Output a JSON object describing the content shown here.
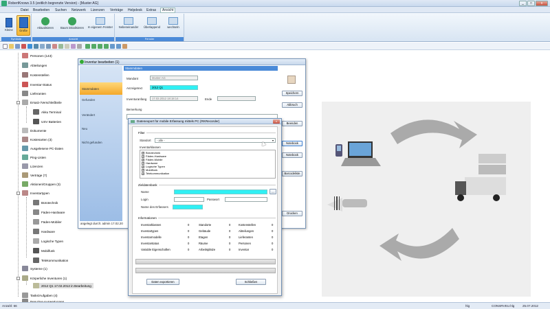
{
  "window": {
    "title": "RobertKnows 3.5 (zeitlich begrenzte Version) - [Muster AG]",
    "min": "_",
    "max": "□",
    "close": "x"
  },
  "menu": [
    "Datei",
    "Bearbeiten",
    "Suchen",
    "Netzwerk",
    "Lizenzen",
    "Verträge",
    "Helpdesk",
    "Extras",
    "Ansicht"
  ],
  "menu_active": "Ansicht",
  "ribbon": {
    "groups": [
      {
        "label": "Symbole",
        "buttons": [
          "Kleine",
          "Große"
        ]
      },
      {
        "label": "Ansicht",
        "buttons": [
          "Aktualisieren",
          "Baum initialisieren",
          "In eigenem Fenster"
        ]
      },
      {
        "label": "Fenster",
        "buttons": [
          "Nebeneinander",
          "Überlappend",
          "wechseln"
        ]
      }
    ],
    "selected": "Große"
  },
  "tree": [
    {
      "label": "Personen (143)",
      "color": "#c77"
    },
    {
      "label": "Abteilungen",
      "color": "#799"
    },
    {
      "label": "Kostenstellen",
      "color": "#977"
    },
    {
      "label": "Inventar-Status",
      "color": "#c55"
    },
    {
      "label": "Lieferanten",
      "color": "#888"
    },
    {
      "label": "Ersatz-/Verschleißteile",
      "color": "#aaa"
    },
    {
      "label": "Akku Terminal",
      "color": "#666"
    },
    {
      "label": "USV Batterien",
      "color": "#555"
    },
    {
      "label": "Dokumente",
      "color": "#bbb"
    },
    {
      "label": "Kostenarten (3)",
      "color": "#a88"
    },
    {
      "label": "Ausgelesene PC-Daten",
      "color": "#69a"
    },
    {
      "label": "Ping-Listen",
      "color": "#6a9"
    },
    {
      "label": "Lizenzen",
      "color": "#99a"
    },
    {
      "label": "Verträge (7)",
      "color": "#a97"
    },
    {
      "label": "Aktionen/Gruppen (3)",
      "color": "#7a6"
    },
    {
      "label": "Inventartypen",
      "color": "#b88"
    },
    {
      "label": "Bürotechnik",
      "color": "#777"
    },
    {
      "label": "Fäden-Hardware",
      "color": "#888"
    },
    {
      "label": "Fäden-Mobiler",
      "color": "#999"
    },
    {
      "label": "Hardware",
      "color": "#777"
    },
    {
      "label": "Logische Typen",
      "color": "#aaa"
    },
    {
      "label": "Mobilfunk",
      "color": "#555"
    },
    {
      "label": "Telekommunikation",
      "color": "#666"
    },
    {
      "label": "Systeme (1)",
      "color": "#889"
    },
    {
      "label": "Körperliche Inventuren (1)",
      "color": "#aa8"
    },
    {
      "label": "2012 Q1 17.02.2012 in Bearbeitung",
      "color": "#bb9"
    },
    {
      "label": "Tasks/Aufgaben (4)",
      "color": "#999"
    },
    {
      "label": "Benutzer-Auswertungen",
      "color": "#888"
    }
  ],
  "status": {
    "left": "Anzahl: 66",
    "mid": "hlg",
    "right1": "CONSRVEU.hlg",
    "right2": "25.07.2012"
  },
  "inventory_window": {
    "title": "Inventur bearbeiten (1)",
    "header": "Stammdaten",
    "nav": [
      "Stammdaten",
      "Gefunden",
      "Verändert",
      "Neu",
      "Nicht gefunden"
    ],
    "fields": {
      "mandant_label": "Mandant",
      "mandant_value": "Muster AG",
      "anzeige_label": "Anzeigetext",
      "anzeige_value": "2012 Q1",
      "anfang_label": "Inventuranfang",
      "anfang_value": "17.02.2012 18:18:14",
      "ende_label": "Ende",
      "bemerkung_label": "Bemerkung"
    },
    "footer": "angelegt durch: admin 17.02.20",
    "buttons": [
      "Speichern",
      "Abbruch",
      "Beenden",
      "Notebook",
      "Notebook",
      "Barcodeliste",
      "Drucken"
    ]
  },
  "export_dialog": {
    "title": "Datenexport für mobile Erfassung mittels PC (RKRecorder)",
    "filter_label": "Filter",
    "standort_label": "Standort",
    "standort_value": "- alle -",
    "inventarklassen_label": "Inventarklassen",
    "klassen": [
      "Bürotechnik",
      "Fäden-Hardware",
      "Fäden-Mobile",
      "Hardware",
      "Logische Typen",
      "Mobilfunk",
      "Telekommunikation"
    ],
    "zieldatenbank_label": "Zieldatenbank",
    "name_label": "Name",
    "login_label": "Login",
    "passwort_label": "Passwort",
    "ersteller_label": "Name des Erfassers",
    "informationen_label": "Informationen",
    "info": [
      [
        "Inventarklassen",
        "0",
        "Standorte",
        "0",
        "Kostenstellen",
        "0"
      ],
      [
        "Inventartypen",
        "0",
        "Gebäude",
        "0",
        "Abteilungen",
        "0"
      ],
      [
        "Inventarmodelle",
        "0",
        "Etagen",
        "0",
        "Lieferanten",
        "0"
      ],
      [
        "Inventarstatus",
        "0",
        "Räume",
        "0",
        "Personen",
        "0"
      ],
      [
        "Variable Eigenschaften",
        "0",
        "Arbeitsplätze",
        "0",
        "Inventar",
        "0"
      ]
    ],
    "export_button": "Daten exportieren",
    "close_button": "Schließen",
    "browse": "..."
  }
}
